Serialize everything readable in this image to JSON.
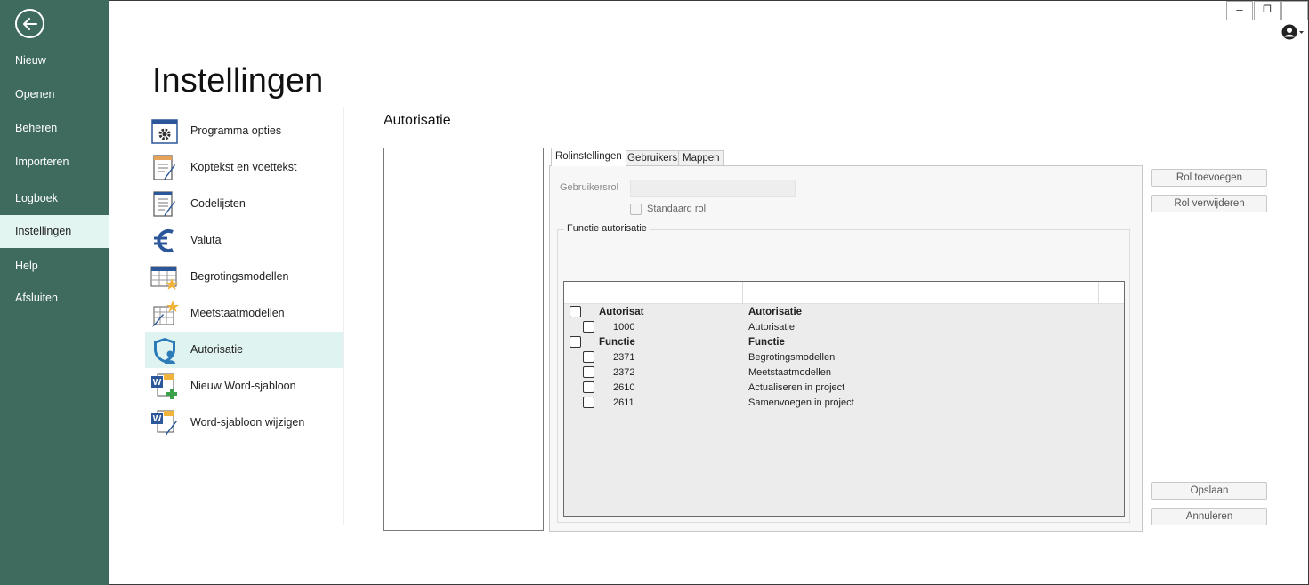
{
  "window": {
    "minimize_glyph": "–",
    "restore_glyph": "❐",
    "close_glyph": ""
  },
  "nav": {
    "items": [
      {
        "label": "Nieuw"
      },
      {
        "label": "Openen"
      },
      {
        "label": "Beheren"
      },
      {
        "label": "Importeren"
      },
      {
        "label": "Logboek"
      },
      {
        "label": "Instellingen",
        "active": true
      },
      {
        "label": "Help"
      },
      {
        "label": "Afsluiten"
      }
    ]
  },
  "page": {
    "title": "Instellingen"
  },
  "settings": {
    "items": [
      {
        "label": "Programma opties",
        "icon": "gear-window-icon"
      },
      {
        "label": "Koptekst en voettekst",
        "icon": "document-edit-icon"
      },
      {
        "label": "Codelijsten",
        "icon": "list-edit-icon"
      },
      {
        "label": "Valuta",
        "icon": "euro-icon"
      },
      {
        "label": "Begrotingsmodellen",
        "icon": "table-star-icon"
      },
      {
        "label": "Meetstaatmodellen",
        "icon": "grid-star-pencil-icon"
      },
      {
        "label": "Autorisatie",
        "icon": "shield-user-icon",
        "active": true
      },
      {
        "label": "Nieuw Word-sjabloon",
        "icon": "word-add-icon"
      },
      {
        "label": "Word-sjabloon wijzigen",
        "icon": "word-edit-icon"
      }
    ]
  },
  "auth": {
    "title": "Autorisatie",
    "tabs": [
      {
        "label": "Rolinstellingen",
        "active": true
      },
      {
        "label": "Gebruikers"
      },
      {
        "label": "Mappen"
      }
    ],
    "user_role_label": "Gebruikersrol",
    "user_role_value": "",
    "default_role_label": "Standaard rol",
    "function_group_label": "Functie autorisatie",
    "rows": [
      {
        "code": "Autorisat",
        "name": "Autorisatie",
        "group": true
      },
      {
        "code": "1000",
        "name": "Autorisatie",
        "group": false
      },
      {
        "code": "Functie",
        "name": "Functie",
        "group": true
      },
      {
        "code": "2371",
        "name": "Begrotingsmodellen",
        "group": false
      },
      {
        "code": "2372",
        "name": "Meetstaatmodellen",
        "group": false
      },
      {
        "code": "2610",
        "name": "Actualiseren in project",
        "group": false
      },
      {
        "code": "2611",
        "name": "Samenvoegen in project",
        "group": false
      }
    ],
    "buttons": {
      "add_role": "Rol toevoegen",
      "remove_role": "Rol verwijderen",
      "save": "Opslaan",
      "cancel": "Annuleren"
    }
  },
  "colors": {
    "nav_bg": "#3f6b5e",
    "nav_active": "#e2f5f1",
    "list_active": "#dff3f0"
  }
}
